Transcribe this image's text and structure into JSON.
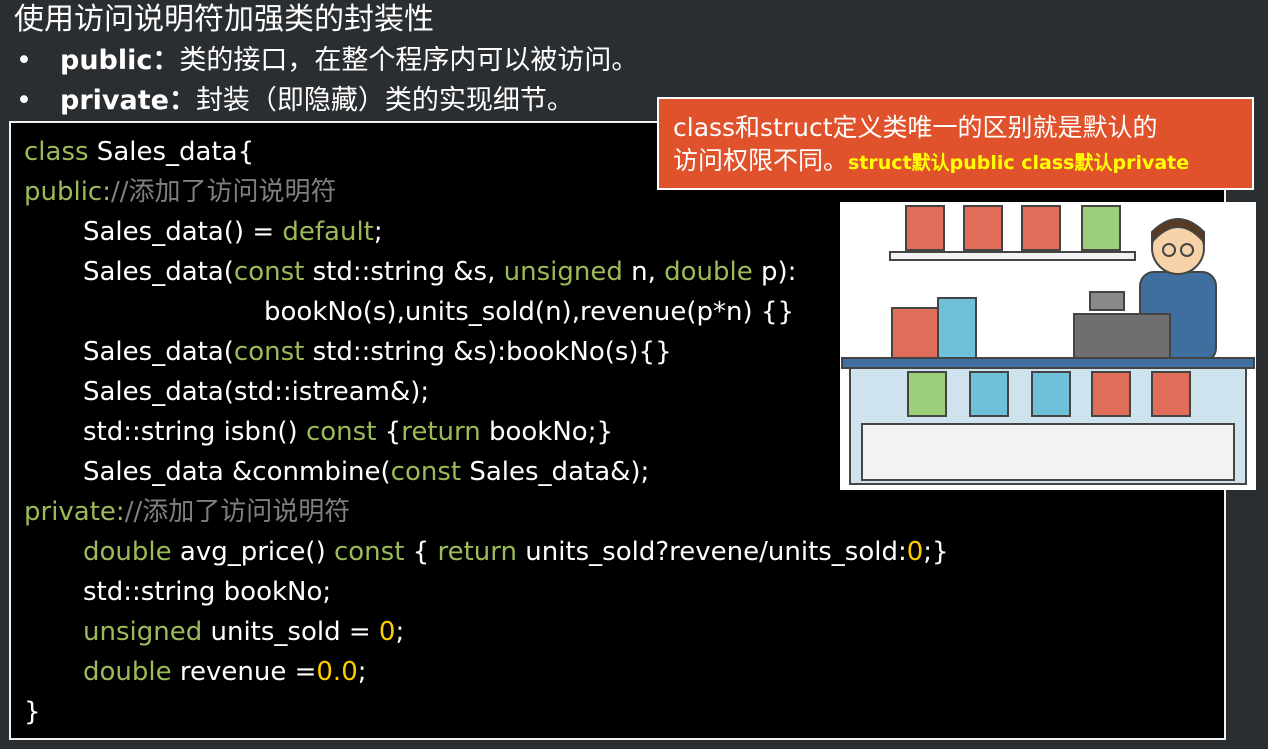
{
  "slide": {
    "title": "使用访问说明符加强类的封装性",
    "bullets": [
      {
        "keyword": "public：",
        "text": "类的接口，在整个程序内可以被访问。"
      },
      {
        "keyword": "private：",
        "text": "封装（即隐藏）类的实现细节。"
      }
    ]
  },
  "callout": {
    "line1": "class和struct定义类唯一的区别就是默认的",
    "line2": "访问权限不同。",
    "note": "struct默认public  class默认private"
  },
  "code": {
    "l1_kw": "class",
    "l1_rest": " Sales_data{",
    "l2_kw": "public:",
    "l2_comment": "//添加了访问说明符",
    "l3_a": "Sales_data() = ",
    "l3_kw": "default",
    "l3_b": ";",
    "l4_a": "Sales_data(",
    "l4_kw1": "const",
    "l4_b": " std::string &s, ",
    "l4_kw2": "unsigned",
    "l4_c": " n, ",
    "l4_kw3": "double",
    "l4_d": " p):",
    "l5": "bookNo(s),units_sold(n),revenue(p*n) {}",
    "l6_a": "Sales_data(",
    "l6_kw": "const",
    "l6_b": " std::string &s):bookNo(s){}",
    "l7": "Sales_data(std::istream&);",
    "l8_a": "std::string isbn() ",
    "l8_kw1": "const",
    "l8_b": " {",
    "l8_kw2": "return",
    "l8_c": " bookNo;}",
    "l9_a": "Sales_data &conmbine(",
    "l9_kw": "const",
    "l9_b": " Sales_data&);",
    "l10_kw": "private:",
    "l10_comment": "//添加了访问说明符",
    "l11_kw1": "double",
    "l11_a": " avg_price() ",
    "l11_kw2": "const",
    "l11_b": " { ",
    "l11_kw3": "return",
    "l11_c": " units_sold?revene/units_sold:",
    "l11_num": "0",
    "l11_d": ";}",
    "l12": "std::string bookNo;",
    "l13_kw": "unsigned",
    "l13_a": " units_sold = ",
    "l13_num": "0",
    "l13_b": ";",
    "l14_kw": "double",
    "l14_a": " revenue =",
    "l14_num": "0.0",
    "l14_b": ";",
    "l15": "}"
  },
  "colors": {
    "keyword": "#9bbb59",
    "number": "#ffcc00",
    "comment": "#7f7f7f",
    "callout_bg": "#e0522b",
    "callout_note": "#ffff00"
  },
  "icons": {
    "illustration": "bookstore-clerk-illustration"
  }
}
